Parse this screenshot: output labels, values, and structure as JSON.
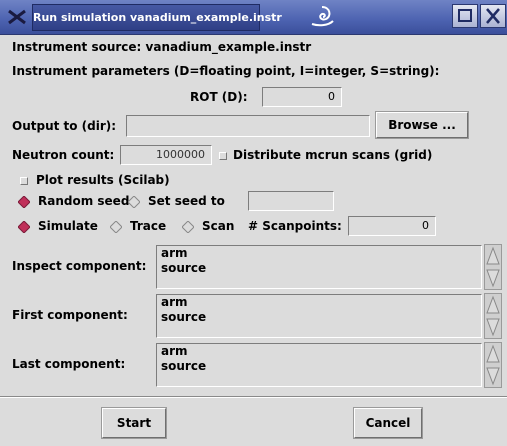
{
  "window": {
    "title": "Run simulation vanadium_example.instr"
  },
  "instrument_source": "Instrument source: vanadium_example.instr",
  "instrument_params_label": "Instrument parameters (D=floating point, I=integer, S=string):",
  "rot": {
    "label": "ROT (D):",
    "value": "0"
  },
  "output": {
    "label": "Output to (dir):",
    "value": "",
    "browse": "Browse ..."
  },
  "neutron": {
    "label": "Neutron count:",
    "value": "1000000",
    "distribute": "Distribute mcrun scans (grid)"
  },
  "plot": {
    "label": "Plot results (Scilab)"
  },
  "seed": {
    "random": "Random seed",
    "set": "Set seed to",
    "value": ""
  },
  "mode": {
    "simulate": "Simulate",
    "trace": "Trace",
    "scan": "Scan",
    "scanpoints_label": "# Scanpoints:",
    "scanpoints_value": "0"
  },
  "components": {
    "inspect": {
      "label": "Inspect component:",
      "items": [
        "arm",
        "source"
      ]
    },
    "first": {
      "label": "First component:",
      "items": [
        "arm",
        "source"
      ]
    },
    "last": {
      "label": "Last component:",
      "items": [
        "arm",
        "source"
      ]
    }
  },
  "buttons": {
    "start": "Start",
    "cancel": "Cancel"
  },
  "colors": {
    "titlebar": "#4c62b0",
    "window_bg": "#dcdcdc",
    "radio_on": "#c0305a"
  }
}
